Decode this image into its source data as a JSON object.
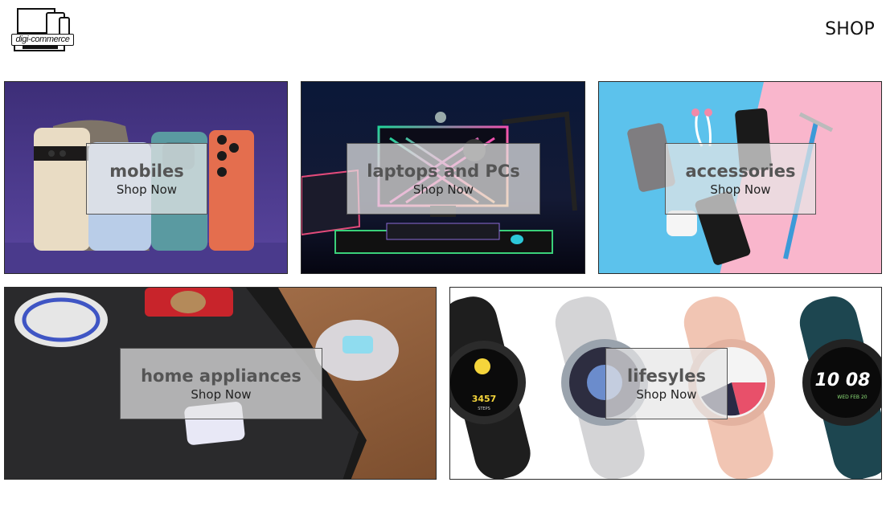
{
  "header": {
    "logo_text": "digi-commerce",
    "nav_shop": "SHOP"
  },
  "categories": [
    {
      "title": "mobiles",
      "cta": "Shop Now"
    },
    {
      "title": "laptops and PCs",
      "cta": "Shop Now"
    },
    {
      "title": "accessories",
      "cta": "Shop Now"
    },
    {
      "title": "home appliances",
      "cta": "Shop Now"
    },
    {
      "title": "lifesyles",
      "cta": "Shop Now"
    }
  ],
  "smartwatch_faces": {
    "steps": "3457",
    "steps_label": "STEPS",
    "time": "10 08",
    "date": "WED FEB 20"
  }
}
